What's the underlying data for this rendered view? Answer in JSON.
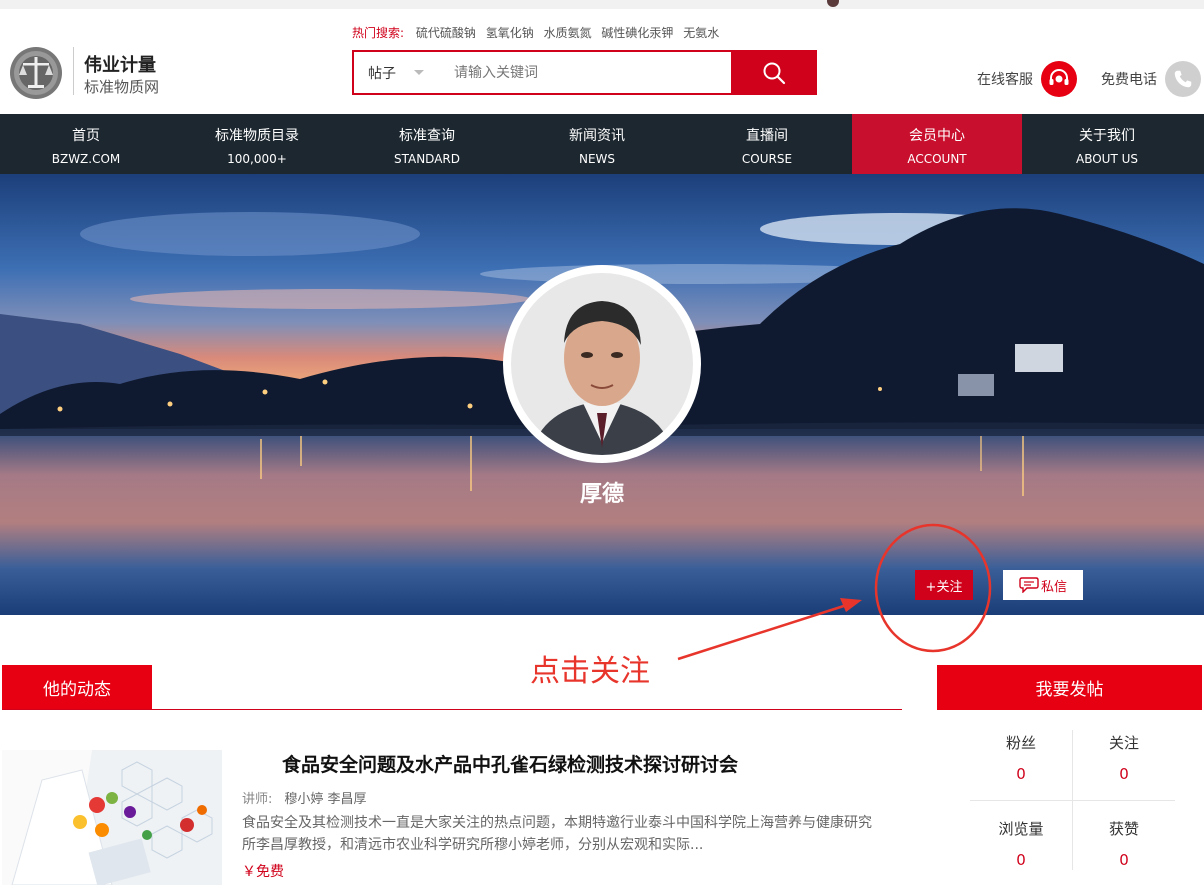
{
  "header": {
    "brand_name": "伟业计量",
    "brand_sub": "标准物质网",
    "hot_label": "热门搜索:",
    "hot_items": [
      "硫代硫酸钠",
      "氢氧化钠",
      "水质氨氮",
      "碱性碘化汞钾",
      "无氨水"
    ],
    "search_category": "帖子",
    "search_placeholder": "请输入关键词",
    "service_label": "在线客服",
    "phone_label": "免费电话"
  },
  "nav": [
    {
      "cn": "首页",
      "en": "BZWZ.COM"
    },
    {
      "cn": "标准物质目录",
      "en": "100,000+"
    },
    {
      "cn": "标准查询",
      "en": "STANDARD"
    },
    {
      "cn": "新闻资讯",
      "en": "NEWS"
    },
    {
      "cn": "直播间",
      "en": "COURSE"
    },
    {
      "cn": "会员中心",
      "en": "ACCOUNT",
      "active": true
    },
    {
      "cn": "关于我们",
      "en": "ABOUT US"
    }
  ],
  "profile": {
    "name": "厚德",
    "follow_label": "+关注",
    "message_label": "私信"
  },
  "annotation": {
    "text": "点击关注"
  },
  "main": {
    "tab_label": "他的动态",
    "posts": [
      {
        "title": "食品安全问题及水产品中孔雀石绿检测技术探讨研讨会",
        "lecturer_label": "讲师:",
        "lecturers": "穆小婷 李昌厚",
        "description": "食品安全及其检测技术一直是大家关注的热点问题，本期特邀行业泰斗中国科学院上海营养与健康研究所李昌厚教授，和清远市农业科学研究所穆小婷老师，分别从宏观和实际...",
        "price": "￥免费"
      }
    ]
  },
  "sidebar": {
    "post_button": "我要发帖",
    "stats": [
      {
        "label": "粉丝",
        "value": "0"
      },
      {
        "label": "关注",
        "value": "0"
      },
      {
        "label": "浏览量",
        "value": "0"
      },
      {
        "label": "获赞",
        "value": "0"
      }
    ]
  },
  "colors": {
    "brand_red": "#d0021b",
    "nav_bg": "#1d2730",
    "annotation_red": "#e8352c"
  }
}
